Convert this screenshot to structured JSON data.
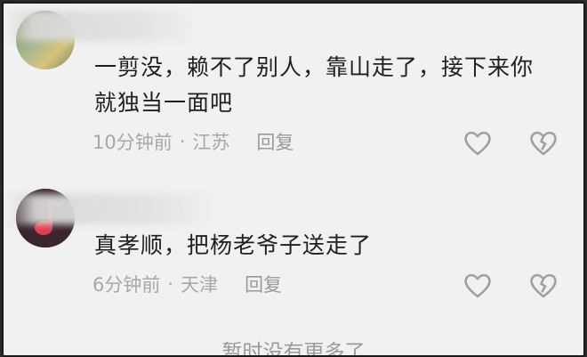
{
  "comments": [
    {
      "text_line1": "一剪没，赖不了别人，靠山走了，接下来你",
      "text_line2": "就独当一面吧",
      "time": "10分钟前",
      "separator": "·",
      "location": "江苏",
      "reply_label": "回复",
      "like_icon": "heart-outline-icon",
      "dislike_icon": "broken-heart-icon"
    },
    {
      "text_line1": "真孝顺，把杨老爷子送走了",
      "time": "6分钟前",
      "separator": "·",
      "location": "天津",
      "reply_label": "回复",
      "like_icon": "heart-outline-icon",
      "dislike_icon": "broken-heart-icon"
    }
  ],
  "footer": {
    "text": "暂时没有更多了"
  }
}
